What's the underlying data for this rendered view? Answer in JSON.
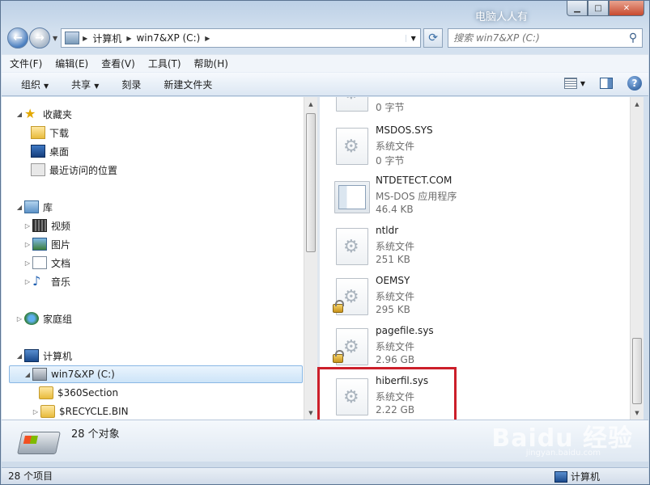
{
  "window": {
    "title": "电脑人人有"
  },
  "nav": {
    "address_segments": [
      "计算机",
      "win7&XP (C:)"
    ],
    "search_placeholder": "搜索 win7&XP (C:)"
  },
  "menu": [
    "文件(F)",
    "编辑(E)",
    "查看(V)",
    "工具(T)",
    "帮助(H)"
  ],
  "toolbar": {
    "organize": "组织",
    "share": "共享",
    "burn": "刻录",
    "new_folder": "新建文件夹"
  },
  "tree": {
    "favorites": "收藏夹",
    "downloads": "下载",
    "desktop": "桌面",
    "recent": "最近访问的位置",
    "libraries": "库",
    "videos": "视频",
    "pictures": "图片",
    "documents": "文档",
    "music": "音乐",
    "homegroup": "家庭组",
    "computer": "计算机",
    "drive": "win7&XP (C:)",
    "folder1": "$360Section",
    "folder2": "$RECYCLE.BIN"
  },
  "files": [
    {
      "name": "",
      "type": "",
      "size": "0 字节",
      "icon": "gear-file-icon",
      "locked": false
    },
    {
      "name": "MSDOS.SYS",
      "type": "系统文件",
      "size": "0 字节",
      "icon": "gear-file-icon",
      "locked": false
    },
    {
      "name": "NTDETECT.COM",
      "type": "MS-DOS 应用程序",
      "size": "46.4 KB",
      "icon": "app-window-icon",
      "locked": false
    },
    {
      "name": "ntldr",
      "type": "系统文件",
      "size": "251 KB",
      "icon": "gear-file-icon",
      "locked": false
    },
    {
      "name": "OEMSY",
      "type": "系统文件",
      "size": "295 KB",
      "icon": "gear-file-icon",
      "locked": true
    },
    {
      "name": "pagefile.sys",
      "type": "系统文件",
      "size": "2.96 GB",
      "icon": "gear-file-icon",
      "locked": true
    },
    {
      "name": "hiberfil.sys",
      "type": "系统文件",
      "size": "2.22 GB",
      "icon": "gear-file-icon",
      "locked": false
    }
  ],
  "details": {
    "count_text": "28 个对象"
  },
  "status": {
    "items_text": "28 个项目",
    "location": "计算机"
  },
  "watermark": {
    "brand": "Baidu 经验",
    "url": "jingyan.baidu.com"
  },
  "colors": {
    "highlight": "#cc1f2a",
    "selection": "#cde4f8"
  }
}
